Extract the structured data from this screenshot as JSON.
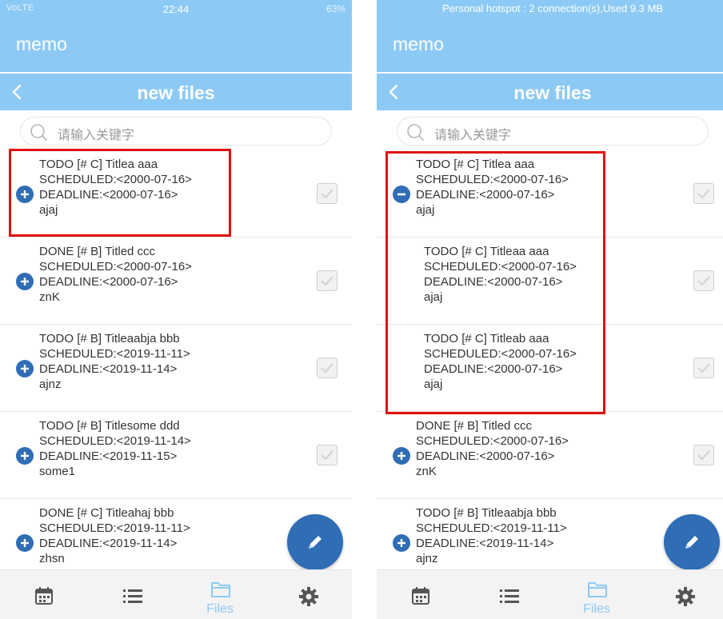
{
  "left": {
    "status": {
      "network": "VoLTE",
      "time": "22:44",
      "battery": "63%"
    },
    "app_title": "memo",
    "subheader_title": "new files",
    "search_placeholder": "请输入关键字",
    "items": [
      {
        "lines": [
          "TODO [# C] Titlea aaa",
          "SCHEDULED:<2000-07-16>",
          "DEADLINE:<2000-07-16>",
          "ajaj"
        ],
        "toggle": "expand"
      },
      {
        "lines": [
          "DONE [# B] Titled ccc",
          "SCHEDULED:<2000-07-16>",
          "DEADLINE:<2000-07-16>",
          "znK"
        ],
        "toggle": "expand"
      },
      {
        "lines": [
          "TODO [# B] Titleaabja bbb",
          "SCHEDULED:<2019-11-11>",
          "DEADLINE:<2019-11-14>",
          "ajnz"
        ],
        "toggle": "expand"
      },
      {
        "lines": [
          "TODO [# B] Titlesome ddd",
          "SCHEDULED:<2019-11-14>",
          "DEADLINE:<2019-11-15>",
          "some1"
        ],
        "toggle": "expand"
      },
      {
        "lines": [
          "DONE [# C] Titleahaj bbb",
          "SCHEDULED:<2019-11-11>",
          "DEADLINE:<2019-11-14>",
          "zhsn"
        ],
        "toggle": "expand"
      }
    ],
    "nav": {
      "active_label": "Files"
    }
  },
  "right": {
    "status": {
      "hotspot": "Personal hotspot : 2 connection(s),Used  9.3 MB"
    },
    "app_title": "memo",
    "subheader_title": "new files",
    "search_placeholder": "请输入关键字",
    "items": [
      {
        "lines": [
          "TODO [# C] Titlea aaa",
          "SCHEDULED:<2000-07-16>",
          "DEADLINE:<2000-07-16>",
          "ajaj"
        ],
        "toggle": "collapse"
      },
      {
        "lines": [
          "TODO [# C] Titleaa aaa",
          "SCHEDULED:<2000-07-16>",
          "DEADLINE:<2000-07-16>",
          "ajaj"
        ],
        "toggle": "none"
      },
      {
        "lines": [
          "TODO [# C] Titleab aaa",
          "SCHEDULED:<2000-07-16>",
          "DEADLINE:<2000-07-16>",
          "ajaj"
        ],
        "toggle": "none"
      },
      {
        "lines": [
          "DONE [# B] Titled ccc",
          "SCHEDULED:<2000-07-16>",
          "DEADLINE:<2000-07-16>",
          "znK"
        ],
        "toggle": "expand"
      },
      {
        "lines": [
          "TODO [# B] Titleaabja bbb",
          "SCHEDULED:<2019-11-11>",
          "DEADLINE:<2019-11-14>",
          "ajnz"
        ],
        "toggle": "expand"
      }
    ],
    "nav": {
      "active_label": "Files"
    }
  },
  "colors": {
    "header": "#8dc9f5",
    "accent": "#2f6db5",
    "highlight": "#e01010"
  },
  "icons": [
    "back-chevron-icon",
    "search-icon",
    "expand-plus-icon",
    "collapse-minus-icon",
    "checkbox-icon",
    "edit-pencil-icon",
    "calendar-icon",
    "list-icon",
    "folder-icon",
    "gear-icon"
  ]
}
